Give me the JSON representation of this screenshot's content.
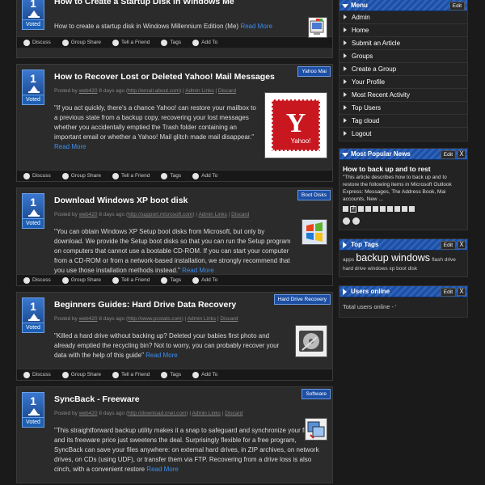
{
  "stories": [
    {
      "votes": "1",
      "voted_label": "Voted",
      "title": "How to Create a Startup Disk in Windows Me",
      "category": "",
      "meta": null,
      "text": "How to create a startup disk in Windows Millennium Edition (Me)",
      "read_more": "Read More",
      "icon": "windows-me-icon"
    },
    {
      "votes": "1",
      "voted_label": "Voted",
      "title": "How to Recover Lost or Deleted Yahoo! Mail Messages",
      "category": "Yahoo Mai",
      "meta": {
        "posted_by": "Posted by",
        "user": "web420",
        "age": "8 days ago",
        "url": "http://email.about.com",
        "admin": "Admin Links",
        "discard": "Discard"
      },
      "text": "\"If you act quickly, there's a chance Yahoo! can restore your mailbox to a previous state from a backup copy, recovering your lost messages whether you accidentally emptied the Trash folder containing an important email or whether a Yahoo! Mail glitch made mail disappear.\"",
      "read_more": "Read More",
      "icon": "yahoo-mail-stamp-icon"
    },
    {
      "votes": "1",
      "voted_label": "Voted",
      "title": "Download Windows XP boot disk",
      "category": "Boot Disks",
      "meta": {
        "posted_by": "Posted by",
        "user": "web420",
        "age": "8 days ago",
        "url": "http://support.microsoft.com",
        "admin": "Admin Links",
        "discard": "Discard"
      },
      "text": "\"You can obtain Windows XP Setup boot disks from Microsoft, but only by download. We provide the Setup boot disks so that you can run the Setup program on computers that cannot use a bootable CD-ROM. If you can start your computer from a CD-ROM or from a network-based installation, we strongly recommend that you use those installation methods instead.\"",
      "read_more": "Read More",
      "icon": "windows-xp-logo-icon"
    },
    {
      "votes": "1",
      "voted_label": "Voted",
      "title": "Beginners Guides: Hard Drive Data Recovery",
      "category": "Hard Drive Recovery",
      "meta": {
        "posted_by": "Posted by",
        "user": "web420",
        "age": "8 days ago",
        "url": "http://www.pcstats.com",
        "admin": "Admin Links",
        "discard": "Discard"
      },
      "text": "\"Killed a hard drive without backing up? Deleted your babies first photo and already emptied the recycling bin? Not to worry, you can probably recover your data with the help of this guide\"",
      "read_more": "Read More",
      "icon": "hard-drive-icon"
    },
    {
      "votes": "1",
      "voted_label": "Voted",
      "title": "SyncBack - Freeware",
      "category": "Software",
      "meta": {
        "posted_by": "Posted by",
        "user": "web420",
        "age": "8 days ago",
        "url": "http://download.cnet.com",
        "admin": "Admin Links",
        "discard": "Discard"
      },
      "text": "\"This straightforward backup utility makes it a snap to safeguard and synchronize your files, and its freeware price just sweetens the deal. Surprisingly flexible for a free program, SyncBack can save your files anywhere: on external hard drives, in ZIP archives, on network drives, on CDs (using UDF), or transfer them via FTP. Recovering from a drive loss is also cinch, with a convenient restore",
      "read_more": "Read More",
      "icon": "syncback-icon"
    }
  ],
  "actions": [
    "Discuss",
    "Group Share",
    "Tell a Friend",
    "Tags",
    "Add To"
  ],
  "sidebar": {
    "menu": {
      "title": "Menu",
      "edit": "Edit",
      "items": [
        "Admin",
        "Home",
        "Submit an Article",
        "Groups",
        "Create a Group",
        "Your Profile",
        "Most Recent Activity",
        "Top Users",
        "Tag cloud",
        "Logout"
      ]
    },
    "popular": {
      "title": "Most Popular News",
      "edit": "Edit",
      "close": "X",
      "story_title": "How to back up and to rest",
      "story_text": "\"This article describes how to back up and to restore the following items in Microsoft Outlook Express: Messages, The Address Book, Mai accounts, New ...",
      "current_page": "2"
    },
    "tags": {
      "title": "Top Tags",
      "edit": "Edit",
      "close": "X",
      "t1": "apps",
      "t2": "backup windows",
      "t3": "flash drive",
      "t4": "hard drive windows xp boot disk"
    },
    "users": {
      "title": "Users online",
      "edit": "Edit",
      "close": "X",
      "text": "Total users online - '"
    }
  },
  "colors": {
    "accent": "#1d4fa5",
    "link": "#3c8ef0",
    "bg": "#1a1a1a"
  }
}
